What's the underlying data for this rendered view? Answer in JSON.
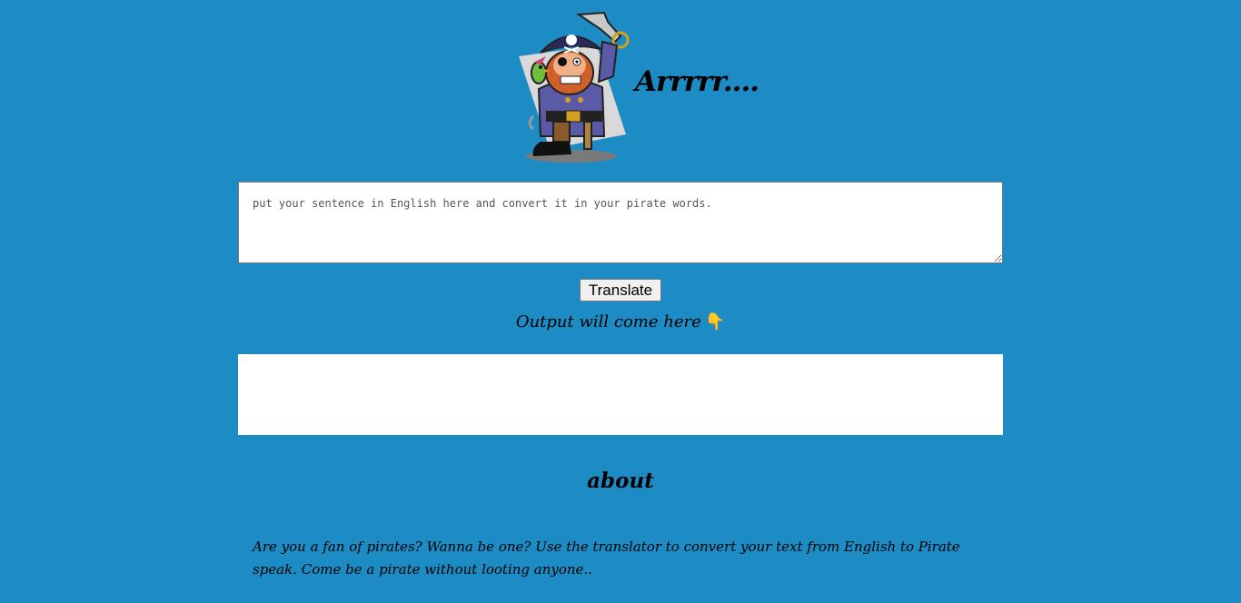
{
  "header": {
    "title": "Arrrrr....",
    "logo_icon": "pirate-icon"
  },
  "translator": {
    "input_placeholder": "put your sentence in English here and convert it in your pirate words.",
    "input_value": "",
    "translate_label": "Translate",
    "output_label": "Output will come here",
    "output_icon": "pointing-down-hand-icon",
    "output_value": ""
  },
  "about": {
    "title": "about",
    "text": "Are you a fan of pirates? Wanna be one? Use the translator to convert your text from English to Pirate speak. Come be a pirate without looting anyone.."
  },
  "colors": {
    "background": "#1d8bc4",
    "panel": "#ffffff"
  }
}
